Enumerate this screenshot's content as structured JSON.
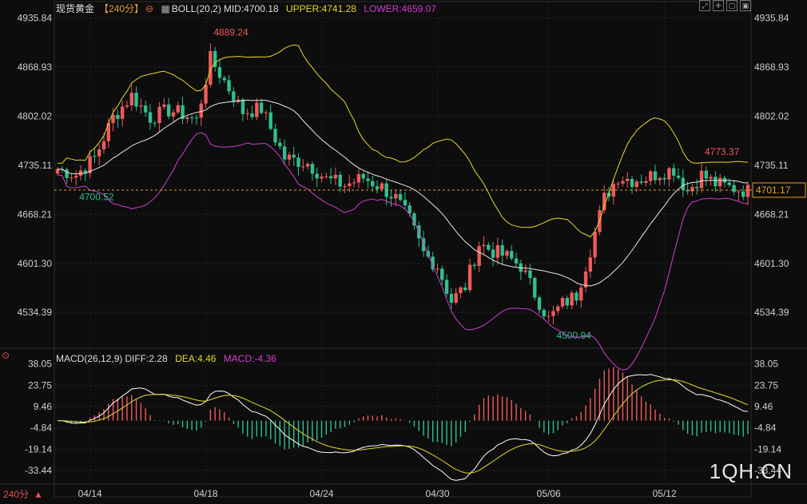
{
  "header": {
    "instrument": "现货黄金",
    "period": "【240分】",
    "period_icon": "minus-circle-icon",
    "boll_icon": "grid-icon",
    "boll_label": "BOLL(20,2)",
    "boll_mid": "MID:4700.18",
    "boll_upper": "UPPER:4741.28",
    "boll_lower": "LOWER:4659.07"
  },
  "macd_header": {
    "icon": "target-icon",
    "label": "MACD(26,12,9)",
    "diff": "DIFF:2.28",
    "dea": "DEA:4.46",
    "macd": "MACD:-4.36"
  },
  "toolbar_icons": [
    "expand-icon",
    "crosshair-icon",
    "window-icon",
    "close-window-icon"
  ],
  "footer": {
    "period": "240分",
    "period_arrow": "▲"
  },
  "watermark": "1QH.CN",
  "colors": {
    "up": "#f05a5a",
    "down": "#2fbf8f",
    "upper": "#e6d82a",
    "lower": "#d43cd4",
    "mid": "#e8e8e8",
    "dea": "#e6d82a",
    "diff": "#ffffff"
  },
  "chart_data": [
    {
      "type": "candlestick",
      "ylim": [
        4490,
        4945
      ],
      "price_ticks": [
        "4935.84",
        "4868.93",
        "4802.02",
        "4735.11",
        "4668.21",
        "4601.30",
        "4534.39"
      ],
      "date_ticks": [
        "04/14",
        "04/18",
        "04/24",
        "04/30",
        "05/06",
        "05/12"
      ],
      "current_price": "4701.17",
      "annotations": [
        {
          "label": "4889.24",
          "kind": "high"
        },
        {
          "label": "4700.52",
          "kind": "low"
        },
        {
          "label": "4500.94",
          "kind": "low"
        },
        {
          "label": "4773.37",
          "kind": "high"
        }
      ],
      "close_path": [
        [
          0,
          4730
        ],
        [
          4,
          4722
        ],
        [
          8,
          4745
        ],
        [
          12,
          4800
        ],
        [
          16,
          4830
        ],
        [
          20,
          4800
        ],
        [
          24,
          4810
        ],
        [
          27,
          4805
        ],
        [
          30,
          4796
        ],
        [
          33,
          4880
        ],
        [
          36,
          4850
        ],
        [
          40,
          4808
        ],
        [
          44,
          4812
        ],
        [
          49,
          4745
        ],
        [
          54,
          4738
        ],
        [
          58,
          4716
        ],
        [
          62,
          4708
        ],
        [
          66,
          4718
        ],
        [
          70,
          4705
        ],
        [
          73,
          4690
        ],
        [
          76,
          4660
        ],
        [
          79,
          4615
        ],
        [
          82,
          4598
        ],
        [
          85,
          4550
        ],
        [
          88,
          4570
        ],
        [
          91,
          4628
        ],
        [
          94,
          4618
        ],
        [
          97,
          4610
        ],
        [
          100,
          4598
        ],
        [
          103,
          4560
        ],
        [
          106,
          4525
        ],
        [
          109,
          4546
        ],
        [
          112,
          4558
        ],
        [
          115,
          4620
        ],
        [
          118,
          4690
        ],
        [
          121,
          4720
        ],
        [
          124,
          4715
        ],
        [
          127,
          4718
        ],
        [
          130,
          4725
        ],
        [
          133,
          4730
        ],
        [
          136,
          4700
        ],
        [
          139,
          4722
        ],
        [
          142,
          4710
        ],
        [
          145,
          4705
        ],
        [
          149,
          4700
        ]
      ]
    },
    {
      "type": "macd",
      "ylim": [
        -42,
        40
      ],
      "ticks": [
        "38.05",
        "23.75",
        "9.46",
        "-4.84",
        "-19.14",
        "-33.44"
      ]
    }
  ]
}
